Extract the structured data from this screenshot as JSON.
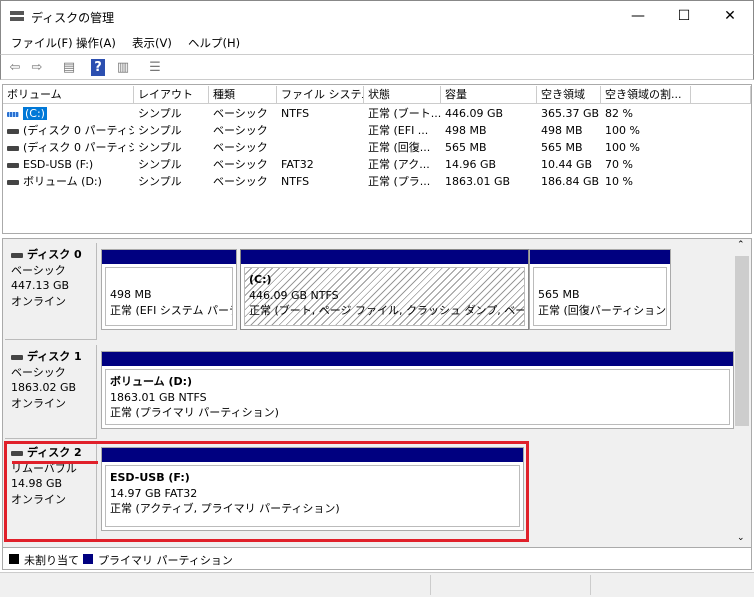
{
  "window": {
    "title": "ディスクの管理",
    "minimize": "—",
    "maximize": "☐",
    "close": "✕"
  },
  "menu": [
    "ファイル(F)",
    "操作(A)",
    "表示(V)",
    "ヘルプ(H)"
  ],
  "columns": [
    "ボリューム",
    "レイアウト",
    "種類",
    "ファイル システム",
    "状態",
    "容量",
    "空き領域",
    "空き領域の割..."
  ],
  "volumes": [
    [
      "(C:)",
      "シンプル",
      "ベーシック",
      "NTFS",
      "正常 (ブート...",
      "446.09 GB",
      "365.37 GB",
      "82 %"
    ],
    [
      "(ディスク 0 パーティシ...",
      "シンプル",
      "ベーシック",
      "",
      "正常 (EFI ...",
      "498 MB",
      "498 MB",
      "100 %"
    ],
    [
      "(ディスク 0 パーティシ...",
      "シンプル",
      "ベーシック",
      "",
      "正常 (回復...",
      "565 MB",
      "565 MB",
      "100 %"
    ],
    [
      "ESD-USB (F:)",
      "シンプル",
      "ベーシック",
      "FAT32",
      "正常 (アク...",
      "14.96 GB",
      "10.44 GB",
      "70 %"
    ],
    [
      "ボリューム (D:)",
      "シンプル",
      "ベーシック",
      "NTFS",
      "正常 (プラ...",
      "1863.01 GB",
      "186.84 GB",
      "10 %"
    ]
  ],
  "disks": [
    {
      "name": "ディスク 0",
      "type": "ベーシック",
      "size": "447.13 GB",
      "status": "オンライン",
      "partitions": [
        {
          "label": "",
          "size": "498 MB",
          "status": "正常 (EFI システム パーティ"
        },
        {
          "label": "(C:)",
          "size": "446.09 GB NTFS",
          "status": "正常 (ブート, ページ ファイル, クラッシュ ダンプ, ベーシック デー"
        },
        {
          "label": "",
          "size": "565 MB",
          "status": "正常 (回復パーティション)"
        }
      ]
    },
    {
      "name": "ディスク 1",
      "type": "ベーシック",
      "size": "1863.02 GB",
      "status": "オンライン",
      "partitions": [
        {
          "label": "ボリューム  (D:)",
          "size": "1863.01 GB NTFS",
          "status": "正常 (プライマリ パーティション)"
        }
      ]
    },
    {
      "name": "ディスク 2",
      "type": "リムーバブル",
      "size": "14.98 GB",
      "status": "オンライン",
      "partitions": [
        {
          "label": "ESD-USB  (F:)",
          "size": "14.97 GB FAT32",
          "status": "正常 (アクティブ, プライマリ パーティション)"
        }
      ]
    }
  ],
  "legend": [
    "未割り当て",
    "プライマリ パーティション"
  ],
  "colors": {
    "primary": "#000080",
    "unallocated": "#000000",
    "highlight": "#e0202a",
    "selection": "#0078d7"
  }
}
